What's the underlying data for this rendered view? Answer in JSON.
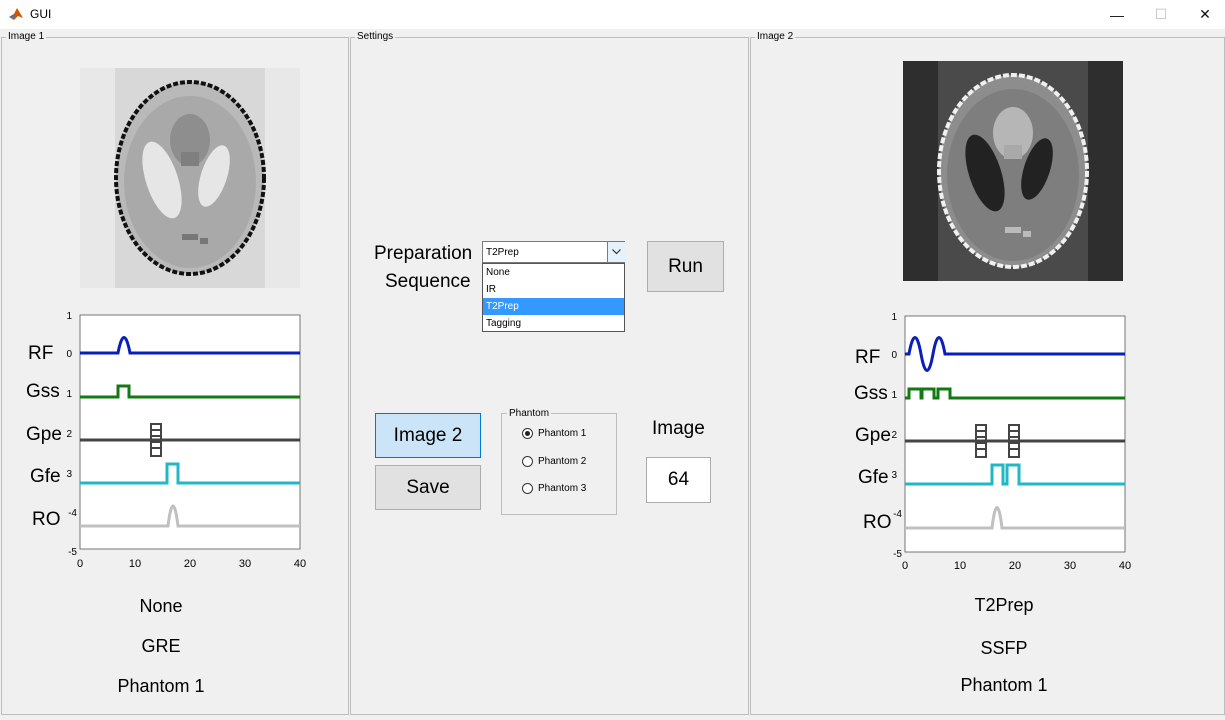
{
  "window": {
    "title": "GUI",
    "minimize_glyph": "—",
    "maximize_glyph": "☐",
    "close_glyph": "✕",
    "app_icon": "matlab-icon"
  },
  "panels": {
    "image1_title": "Image 1",
    "settings_title": "Settings",
    "image2_title": "Image 2"
  },
  "image1": {
    "channel_labels": [
      "RF",
      "Gss",
      "Gpe",
      "Gfe",
      "RO"
    ],
    "y_ticks": [
      "1",
      "0",
      "1",
      "2",
      "3",
      "-4",
      "-5"
    ],
    "x_ticks": [
      "0",
      "10",
      "20",
      "30",
      "40"
    ],
    "prep": "None",
    "sequence": "GRE",
    "phantom": "Phantom 1"
  },
  "image2": {
    "channel_labels": [
      "RF",
      "Gss",
      "Gpe",
      "Gfe",
      "RO"
    ],
    "y_ticks": [
      "1",
      "0",
      "1",
      "2",
      "3",
      "-4",
      "-5"
    ],
    "x_ticks": [
      "0",
      "10",
      "20",
      "30",
      "40"
    ],
    "prep": "T2Prep",
    "sequence": "SSFP",
    "phantom": "Phantom 1"
  },
  "settings": {
    "prep_label_line1": "Preparation",
    "prep_label_line2": "Sequence",
    "dropdown_value": "T2Prep",
    "dropdown_options": [
      "None",
      "IR",
      "T2Prep",
      "Tagging"
    ],
    "dropdown_selected_index": 2,
    "run_label": "Run",
    "image2_button": "Image 2",
    "save_button": "Save",
    "phantom_group_title": "Phantom",
    "phantom_options": [
      "Phantom 1",
      "Phantom 2",
      "Phantom 3"
    ],
    "phantom_selected_index": 0,
    "image_size_label": "Image",
    "image_size_value": "64"
  },
  "colors": {
    "rf": "#0a1fb8",
    "gss": "#117a11",
    "gpe": "#444444",
    "gfe": "#1fb8c4",
    "ro": "#c0c0c0",
    "accent": "#0078d7"
  }
}
